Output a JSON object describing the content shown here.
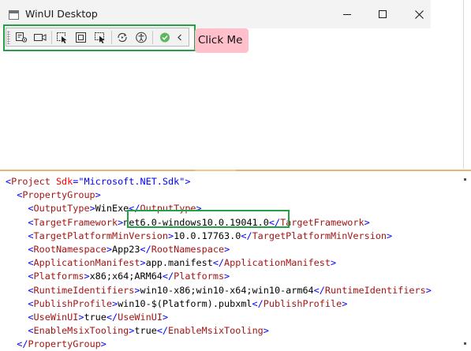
{
  "window": {
    "title": "WinUI Desktop"
  },
  "toolbar": {
    "icons": [
      "go-to-live-visual-tree-icon",
      "show-in-app-toolbar-icon",
      "select-element-icon",
      "display-layout-adorners-icon",
      "track-focused-element-icon",
      "hot-reload-icon",
      "accessibility-checker-icon",
      "hot-reload-status-icon",
      "collapse-toolbar-icon"
    ]
  },
  "click_me_button": {
    "label": "Click Me",
    "color": "#ffc0cb"
  },
  "highlight_color": "#22a247",
  "xml": {
    "lines": [
      [
        {
          "c": "br",
          "t": "<"
        },
        {
          "c": "tag",
          "t": "Project"
        },
        {
          "c": "txt",
          "t": " "
        },
        {
          "c": "attr",
          "t": "Sdk"
        },
        {
          "c": "br",
          "t": "=\""
        },
        {
          "c": "val",
          "t": "Microsoft.NET.Sdk"
        },
        {
          "c": "br",
          "t": "\">"
        }
      ],
      [
        {
          "c": "txt",
          "t": "  "
        },
        {
          "c": "br",
          "t": "<"
        },
        {
          "c": "tag",
          "t": "PropertyGroup"
        },
        {
          "c": "br",
          "t": ">"
        }
      ],
      [
        {
          "c": "txt",
          "t": "    "
        },
        {
          "c": "br",
          "t": "<"
        },
        {
          "c": "tag",
          "t": "OutputType"
        },
        {
          "c": "br",
          "t": ">"
        },
        {
          "c": "txt",
          "t": "WinExe"
        },
        {
          "c": "br",
          "t": "</"
        },
        {
          "c": "tag",
          "t": "OutputType"
        },
        {
          "c": "br",
          "t": ">"
        }
      ],
      [
        {
          "c": "txt",
          "t": "    "
        },
        {
          "c": "br",
          "t": "<"
        },
        {
          "c": "tag",
          "t": "TargetFramework"
        },
        {
          "c": "br",
          "t": ">"
        },
        {
          "c": "txt",
          "t": "net6.0-windows10.0.19041.0"
        },
        {
          "c": "br",
          "t": "</"
        },
        {
          "c": "tag",
          "t": "TargetFramework"
        },
        {
          "c": "br",
          "t": ">"
        }
      ],
      [
        {
          "c": "txt",
          "t": "    "
        },
        {
          "c": "br",
          "t": "<"
        },
        {
          "c": "tag",
          "t": "TargetPlatformMinVersion"
        },
        {
          "c": "br",
          "t": ">"
        },
        {
          "c": "txt",
          "t": "10.0.17763.0"
        },
        {
          "c": "br",
          "t": "</"
        },
        {
          "c": "tag",
          "t": "TargetPlatformMinVersion"
        },
        {
          "c": "br",
          "t": ">"
        }
      ],
      [
        {
          "c": "txt",
          "t": "    "
        },
        {
          "c": "br",
          "t": "<"
        },
        {
          "c": "tag",
          "t": "RootNamespace"
        },
        {
          "c": "br",
          "t": ">"
        },
        {
          "c": "txt",
          "t": "App23"
        },
        {
          "c": "br",
          "t": "</"
        },
        {
          "c": "tag",
          "t": "RootNamespace"
        },
        {
          "c": "br",
          "t": ">"
        }
      ],
      [
        {
          "c": "txt",
          "t": "    "
        },
        {
          "c": "br",
          "t": "<"
        },
        {
          "c": "tag",
          "t": "ApplicationManifest"
        },
        {
          "c": "br",
          "t": ">"
        },
        {
          "c": "txt",
          "t": "app.manifest"
        },
        {
          "c": "br",
          "t": "</"
        },
        {
          "c": "tag",
          "t": "ApplicationManifest"
        },
        {
          "c": "br",
          "t": ">"
        }
      ],
      [
        {
          "c": "txt",
          "t": "    "
        },
        {
          "c": "br",
          "t": "<"
        },
        {
          "c": "tag",
          "t": "Platforms"
        },
        {
          "c": "br",
          "t": ">"
        },
        {
          "c": "txt",
          "t": "x86;x64;ARM64"
        },
        {
          "c": "br",
          "t": "</"
        },
        {
          "c": "tag",
          "t": "Platforms"
        },
        {
          "c": "br",
          "t": ">"
        }
      ],
      [
        {
          "c": "txt",
          "t": "    "
        },
        {
          "c": "br",
          "t": "<"
        },
        {
          "c": "tag",
          "t": "RuntimeIdentifiers"
        },
        {
          "c": "br",
          "t": ">"
        },
        {
          "c": "txt",
          "t": "win10-x86;win10-x64;win10-arm64"
        },
        {
          "c": "br",
          "t": "</"
        },
        {
          "c": "tag",
          "t": "RuntimeIdentifiers"
        },
        {
          "c": "br",
          "t": ">"
        }
      ],
      [
        {
          "c": "txt",
          "t": "    "
        },
        {
          "c": "br",
          "t": "<"
        },
        {
          "c": "tag",
          "t": "PublishProfile"
        },
        {
          "c": "br",
          "t": ">"
        },
        {
          "c": "txt",
          "t": "win10-$(Platform).pubxml"
        },
        {
          "c": "br",
          "t": "</"
        },
        {
          "c": "tag",
          "t": "PublishProfile"
        },
        {
          "c": "br",
          "t": ">"
        }
      ],
      [
        {
          "c": "txt",
          "t": "    "
        },
        {
          "c": "br",
          "t": "<"
        },
        {
          "c": "tag",
          "t": "UseWinUI"
        },
        {
          "c": "br",
          "t": ">"
        },
        {
          "c": "txt",
          "t": "true"
        },
        {
          "c": "br",
          "t": "</"
        },
        {
          "c": "tag",
          "t": "UseWinUI"
        },
        {
          "c": "br",
          "t": ">"
        }
      ],
      [
        {
          "c": "txt",
          "t": "    "
        },
        {
          "c": "br",
          "t": "<"
        },
        {
          "c": "tag",
          "t": "EnableMsixTooling"
        },
        {
          "c": "br",
          "t": ">"
        },
        {
          "c": "txt",
          "t": "true"
        },
        {
          "c": "br",
          "t": "</"
        },
        {
          "c": "tag",
          "t": "EnableMsixTooling"
        },
        {
          "c": "br",
          "t": ">"
        }
      ],
      [
        {
          "c": "txt",
          "t": "  "
        },
        {
          "c": "br",
          "t": "</"
        },
        {
          "c": "tag",
          "t": "PropertyGroup"
        },
        {
          "c": "br",
          "t": ">"
        }
      ]
    ]
  }
}
